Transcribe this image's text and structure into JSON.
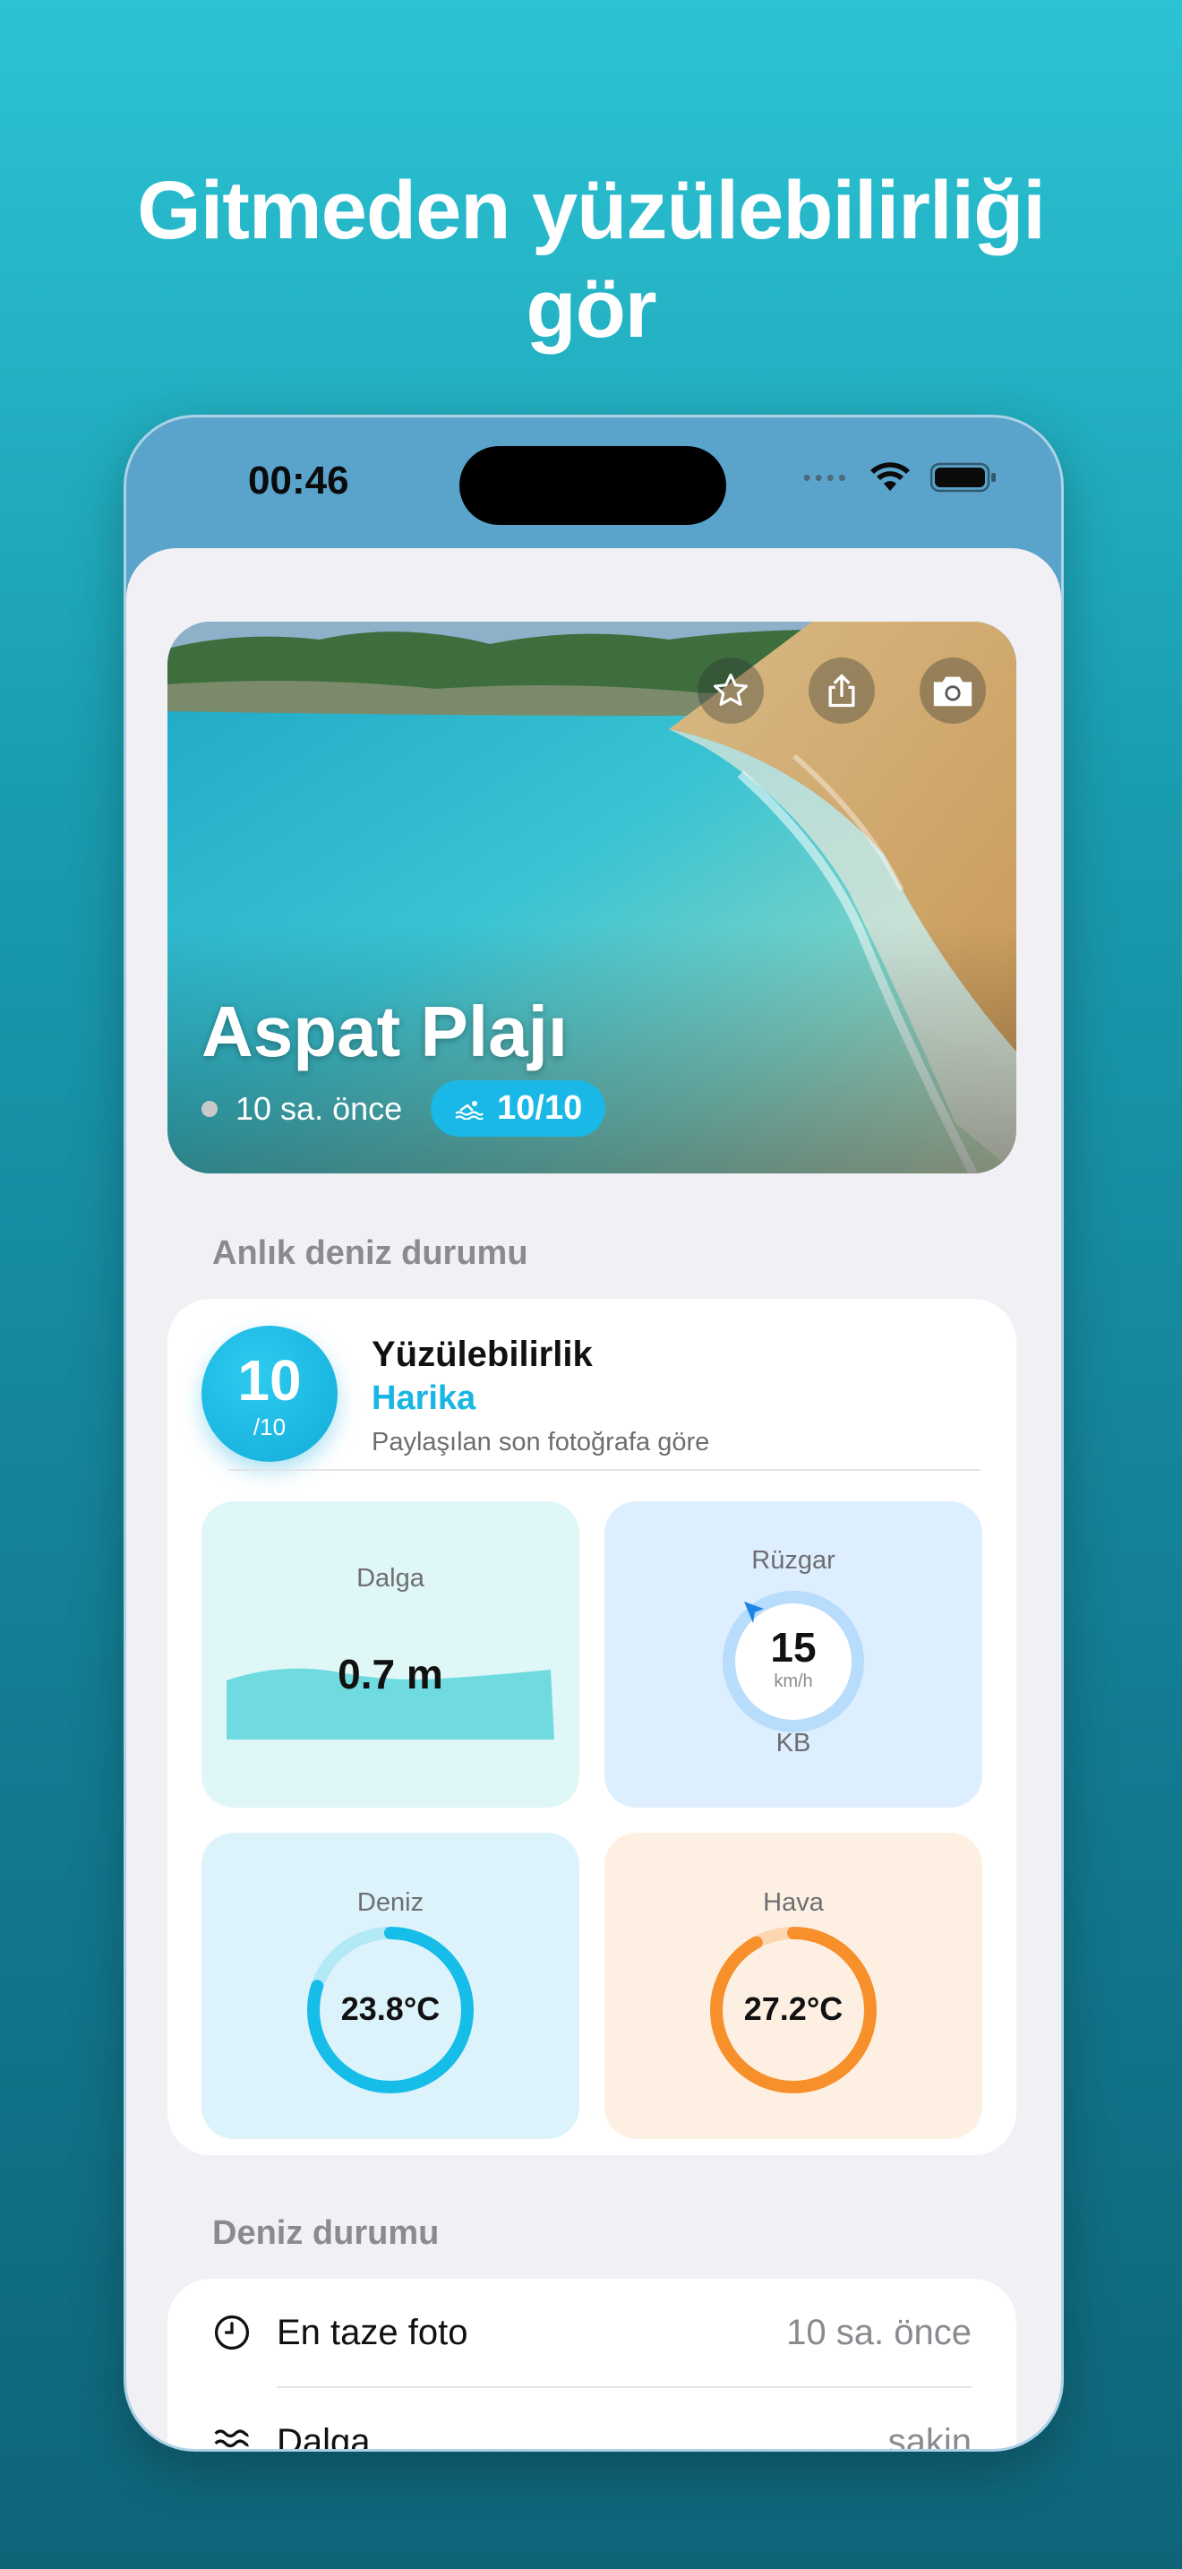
{
  "headline": {
    "line1": "Gitmeden yüzülebilirliği",
    "line2": "gör"
  },
  "status_bar": {
    "time": "00:46"
  },
  "hero": {
    "beach_name": "Aspat Plajı",
    "time_ago": "10 sa. önce",
    "score": "10/10",
    "icons": [
      "star-icon",
      "share-icon",
      "camera-icon"
    ]
  },
  "current_section": {
    "title": "Anlık deniz durumu",
    "swimmability": {
      "score": "10",
      "score_max": "/10",
      "title": "Yüzülebilirlik",
      "grade": "Harika",
      "subtitle": "Paylaşılan son fotoğrafa göre"
    },
    "wave": {
      "label": "Dalga",
      "value": "0.7 m"
    },
    "wind": {
      "label": "Rüzgar",
      "value": "15",
      "unit": "km/h",
      "direction": "KB"
    },
    "sea": {
      "label": "Deniz",
      "value": "23.8°C",
      "gauge_fraction": 0.8
    },
    "air": {
      "label": "Hava",
      "value": "27.2°C",
      "gauge_fraction": 0.92
    }
  },
  "sea_section": {
    "title": "Deniz durumu",
    "rows": [
      {
        "label": "En taze foto",
        "value": "10 sa. önce",
        "icon": "clock-icon"
      },
      {
        "label": "Dalga",
        "value": "sakin",
        "icon": "waves-icon"
      }
    ]
  },
  "colors": {
    "accent": "#19b6e3",
    "wave_tile": "#dff7f6",
    "wind_tile": "#ddeefe",
    "sea_tile": "#ddf3fb",
    "air_tile": "#fdf0e2",
    "air_gauge": "#f7902a"
  }
}
